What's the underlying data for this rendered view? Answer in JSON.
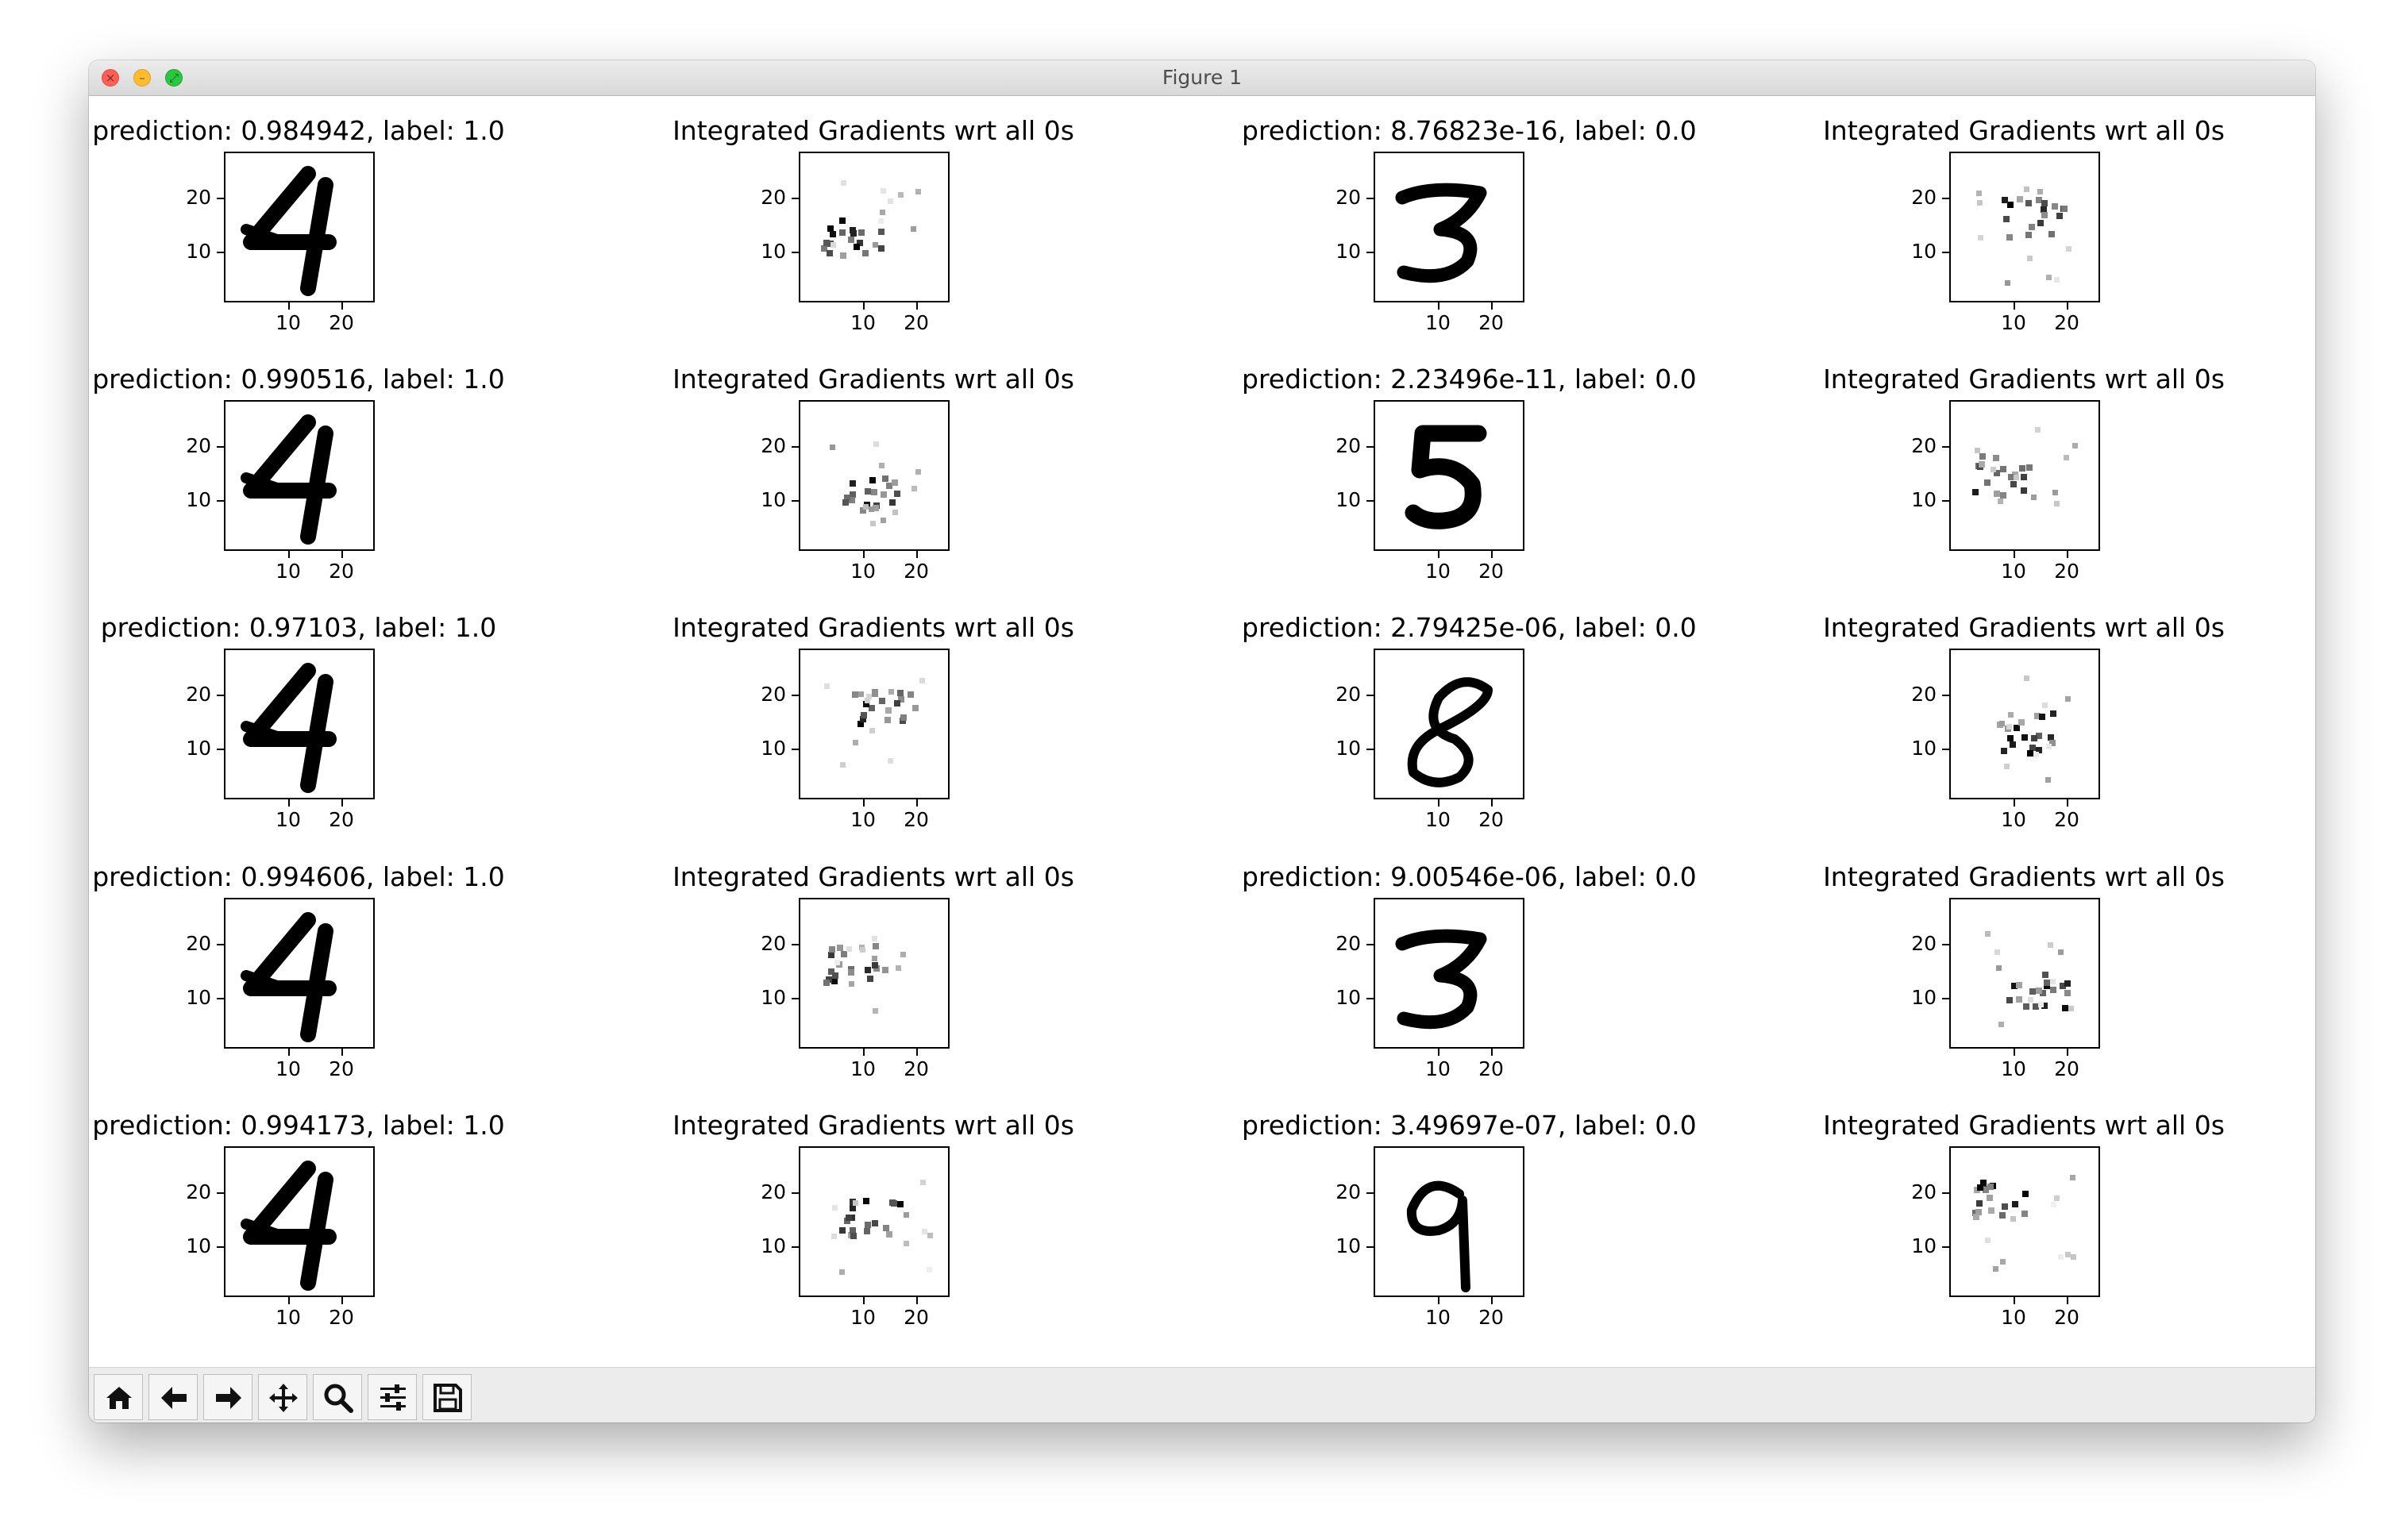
{
  "window": {
    "title": "Figure 1"
  },
  "toolbar": {
    "buttons": [
      {
        "icon": "home-icon"
      },
      {
        "icon": "back-arrow-icon"
      },
      {
        "icon": "forward-arrow-icon"
      },
      {
        "icon": "pan-move-icon"
      },
      {
        "icon": "zoom-magnifier-icon"
      },
      {
        "icon": "subplots-sliders-icon"
      },
      {
        "icon": "save-floppy-icon"
      }
    ]
  },
  "axis": {
    "xticks": [
      "10",
      "20"
    ],
    "yticks": [
      "20",
      "10"
    ]
  },
  "panels": [
    {
      "title": "prediction: 0.984942, label: 1.0",
      "digit": "4"
    },
    {
      "title": "Integrated Gradients wrt all 0s",
      "digit": ""
    },
    {
      "title": "prediction: 8.76823e-16, label: 0.0",
      "digit": "3"
    },
    {
      "title": "Integrated Gradients wrt all 0s",
      "digit": ""
    },
    {
      "title": "prediction: 0.990516, label: 1.0",
      "digit": "4"
    },
    {
      "title": "Integrated Gradients wrt all 0s",
      "digit": ""
    },
    {
      "title": "prediction: 2.23496e-11, label: 0.0",
      "digit": "5"
    },
    {
      "title": "Integrated Gradients wrt all 0s",
      "digit": ""
    },
    {
      "title": "prediction: 0.97103, label: 1.0",
      "digit": "4"
    },
    {
      "title": "Integrated Gradients wrt all 0s",
      "digit": ""
    },
    {
      "title": "prediction: 2.79425e-06, label: 0.0",
      "digit": "8"
    },
    {
      "title": "Integrated Gradients wrt all 0s",
      "digit": ""
    },
    {
      "title": "prediction: 0.994606, label: 1.0",
      "digit": "4"
    },
    {
      "title": "Integrated Gradients wrt all 0s",
      "digit": ""
    },
    {
      "title": "prediction: 9.00546e-06, label: 0.0",
      "digit": "3"
    },
    {
      "title": "Integrated Gradients wrt all 0s",
      "digit": ""
    },
    {
      "title": "prediction: 0.994173, label: 1.0",
      "digit": "4"
    },
    {
      "title": "Integrated Gradients wrt all 0s",
      "digit": ""
    },
    {
      "title": "prediction: 3.49697e-07, label: 0.0",
      "digit": "9"
    },
    {
      "title": "Integrated Gradients wrt all 0s",
      "digit": ""
    }
  ]
}
